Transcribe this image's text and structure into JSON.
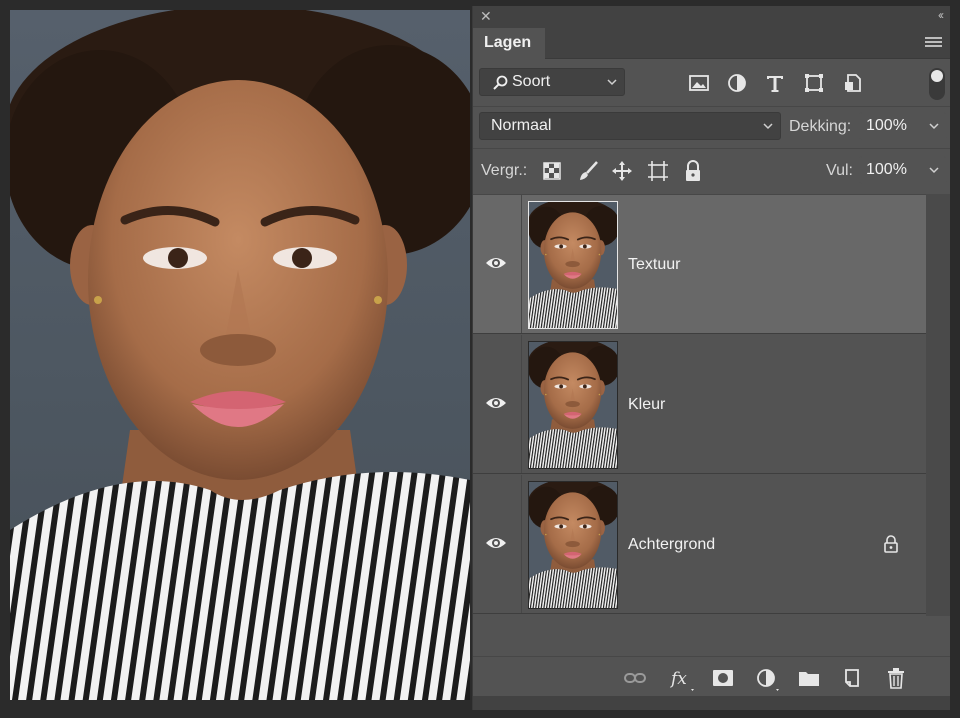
{
  "panel": {
    "tab_label": "Lagen",
    "filter": {
      "value": "Soort"
    },
    "blend_mode": {
      "value": "Normaal"
    },
    "opacity": {
      "label": "Dekking:",
      "value": "100%"
    },
    "lock": {
      "label": "Vergr.:"
    },
    "fill": {
      "label": "Vul:",
      "value": "100%"
    },
    "layers": [
      {
        "name": "Textuur",
        "visible": true,
        "selected": true,
        "locked": false
      },
      {
        "name": "Kleur",
        "visible": true,
        "selected": false,
        "locked": false
      },
      {
        "name": "Achtergrond",
        "visible": true,
        "selected": false,
        "locked": true
      }
    ]
  },
  "colors": {
    "panel_bg": "#535353",
    "selected_layer": "#686868",
    "dark_bar": "#424242",
    "photo_backdrop": "#505a65"
  },
  "icons": {
    "filter_search": "search-icon",
    "filter_types": [
      "image-icon",
      "adjustment-icon",
      "type-icon",
      "shape-icon",
      "smart-object-icon"
    ],
    "lock_types": [
      "lock-transparent-pixels-icon",
      "lock-image-pixels-icon",
      "lock-position-icon",
      "lock-artboard-icon",
      "lock-all-icon"
    ],
    "bottom": [
      "link-layers-icon",
      "fx-icon",
      "mask-icon",
      "adjustment-layer-icon",
      "group-folder-icon",
      "new-layer-icon",
      "trash-icon"
    ]
  }
}
